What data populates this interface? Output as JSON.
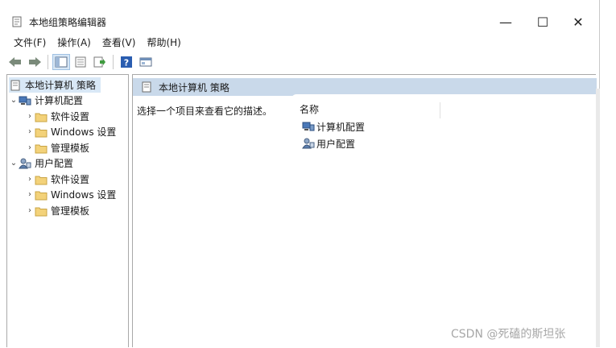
{
  "window": {
    "title": "本地组策略编辑器",
    "controls": {
      "minimize": "—",
      "maximize": "☐",
      "close": "✕"
    }
  },
  "menu": {
    "items": [
      "文件(F)",
      "操作(A)",
      "查看(V)",
      "帮助(H)"
    ]
  },
  "toolbar": {
    "icons": [
      "back-icon",
      "forward-icon",
      "tree-view-icon",
      "properties-icon",
      "export-icon",
      "help-icon",
      "console-icon"
    ]
  },
  "tree": {
    "root": "本地计算机 策略",
    "computer": {
      "label": "计算机配置",
      "children": [
        "软件设置",
        "Windows 设置",
        "管理模板"
      ]
    },
    "user": {
      "label": "用户配置",
      "children": [
        "软件设置",
        "Windows 设置",
        "管理模板"
      ]
    }
  },
  "content": {
    "header": "本地计算机 策略",
    "description": "选择一个项目来查看它的描述。",
    "column_name": "名称",
    "items": [
      "计算机配置",
      "用户配置"
    ]
  },
  "watermark": "CSDN @死磕的斯坦张",
  "colors": {
    "header_bg": "#c9d9ea",
    "selection_bg": "#d9e8f6",
    "folder": "#f3d27a"
  }
}
